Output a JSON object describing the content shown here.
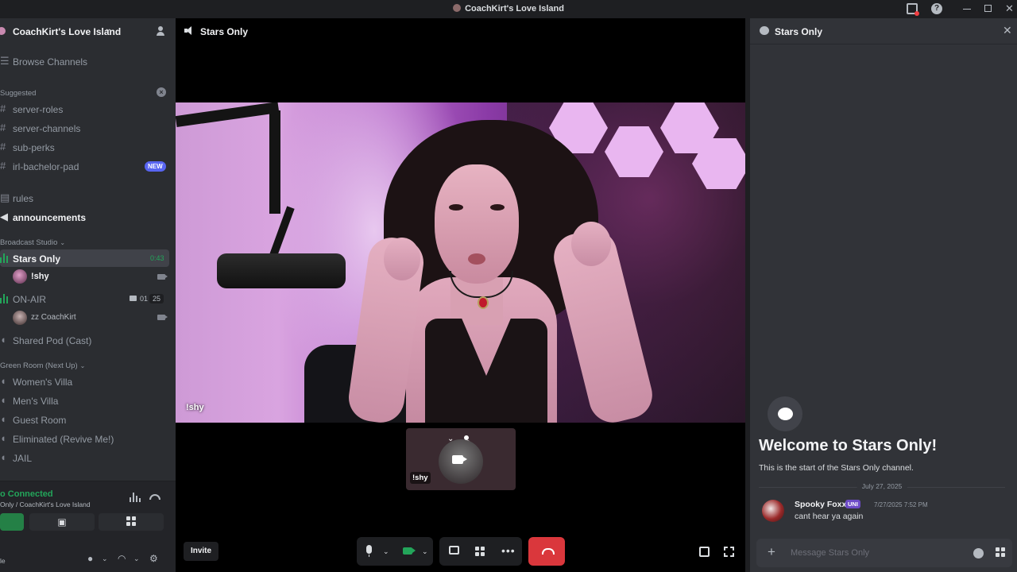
{
  "window": {
    "title": "CoachKirt's Love Island"
  },
  "server": {
    "name": "CoachKirt's Love Island"
  },
  "sidebar": {
    "browse_channels": "Browse Channels",
    "suggested_label": "Suggested",
    "suggested": [
      {
        "name": "server-roles"
      },
      {
        "name": "server-channels"
      },
      {
        "name": "sub-perks"
      },
      {
        "name": "irl-bachelor-pad",
        "badge": "NEW"
      }
    ],
    "rules": "rules",
    "announcements": "announcements",
    "broadcast_category": "Broadcast Studio",
    "stars_only": {
      "name": "Stars Only",
      "timer": "0:43",
      "user": "!shy"
    },
    "on_air": {
      "name": "ON-AIR",
      "video_count": "01",
      "member_count": "25",
      "user": "zz CoachKirt"
    },
    "shared_pod": "Shared Pod (Cast)",
    "green_room_category": "Green Room (Next Up)",
    "green_room": [
      "Women's Villa",
      "Men's Villa",
      "Guest Room",
      "Eliminated (Revive Me!)",
      "JAIL"
    ]
  },
  "voice": {
    "status": "o Connected",
    "location": "Only / CoachKirt's Love Island",
    "user_fragment": "le"
  },
  "stage": {
    "channel": "Stars Only",
    "video_label": "!shy",
    "thumb_label": "!shy",
    "invite": "Invite"
  },
  "chat": {
    "title": "Stars Only",
    "welcome_title": "Welcome to Stars Only!",
    "welcome_sub": "This is the start of the Stars Only channel.",
    "date": "July 27, 2025",
    "message": {
      "author": "Spooky Foxx",
      "badge": "UNI",
      "time": "7/27/2025 7:52 PM",
      "text": "cant hear ya again"
    },
    "placeholder": "Message Stars Only"
  },
  "colors": {
    "online": "#23a55a",
    "brand": "#5865f2",
    "danger": "#da373c",
    "background": "#313338"
  }
}
